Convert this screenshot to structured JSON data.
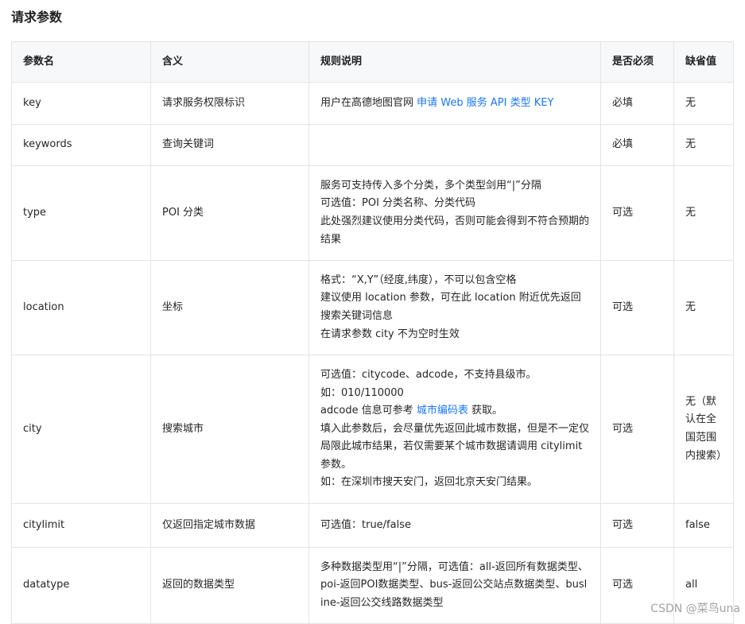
{
  "title": "请求参数",
  "table": {
    "headers": [
      "参数名",
      "含义",
      "规则说明",
      "是否必须",
      "缺省值"
    ],
    "rows": [
      {
        "name": "key",
        "meaning": "请求服务权限标识",
        "rule_lines": [],
        "rule_prefix": "用户在高德地图官网 ",
        "rule_link": "申请 Web 服务 API 类型 KEY",
        "required": "必填",
        "default": "无"
      },
      {
        "name": "keywords",
        "meaning": "查询关键词",
        "required": "必填",
        "default": "无"
      },
      {
        "name": "type",
        "meaning": "POI 分类",
        "rule_lines": [
          "服务可支持传入多个分类，多个类型剑用“|”分隔",
          "可选值：POI 分类名称、分类代码",
          "此处强烈建议使用分类代码，否则可能会得到不符合预期的结果"
        ],
        "required": "可选",
        "default": "无"
      },
      {
        "name": "location",
        "meaning": "坐标",
        "rule_lines": [
          "格式：“X,Y”（经度,纬度），不可以包含空格",
          "建议使用 location 参数，可在此 location 附近优先返回搜索关键词信息",
          "在请求参数 city 不为空时生效"
        ],
        "required": "可选",
        "default": "无"
      },
      {
        "name": "city",
        "meaning": "搜索城市",
        "rule_lines_a": [
          "可选值：citycode、adcode，不支持县级市。",
          "如：010/110000"
        ],
        "rule_ref_prefix": "adcode 信息可参考 ",
        "rule_ref_link": "城市编码表",
        "rule_ref_suffix": " 获取。",
        "rule_lines_b": [
          "填入此参数后，会尽量优先返回此城市数据，但是不一定仅局限此城市结果，若仅需要某个城市数据请调用 citylimit 参数。",
          "如：在深圳市搜天安门，返回北京天安门结果。"
        ],
        "required": "可选",
        "default": "无（默认在全国范围内搜索）"
      },
      {
        "name": "citylimit",
        "meaning": "仅返回指定城市数据",
        "rule_lines": [
          "可选值：true/false"
        ],
        "required": "可选",
        "default": "false"
      },
      {
        "name": "datatype",
        "meaning": "返回的数据类型",
        "rule_lines": [
          "多种数据类型用“|”分隔，可选值：all-返回所有数据类型、poi-返回POI数据类型、bus-返回公交站点数据类型、busline-返回公交线路数据类型"
        ],
        "required": "可选",
        "default": "all"
      }
    ]
  },
  "watermark": "CSDN @菜鸟una",
  "colors": {
    "link": "#1677ff",
    "header_bg": "#f7f8fa",
    "border": "#e4e4e7"
  }
}
